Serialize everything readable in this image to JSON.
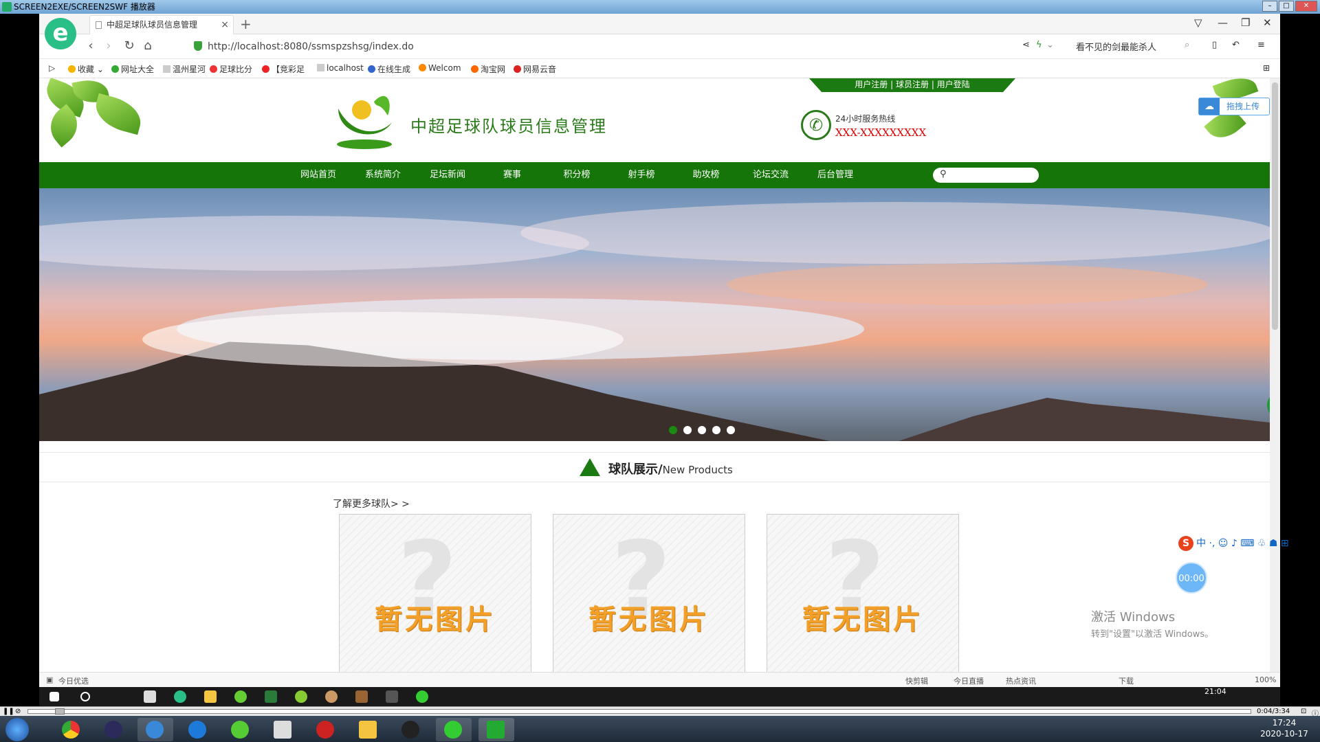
{
  "player": {
    "title": "SCREEN2EXE/SCREEN2SWF 播放器",
    "elapsed": "0:04/3:34"
  },
  "browser": {
    "tab_title": "中超足球队球员信息管理",
    "url": "http://localhost:8080/ssmspzshsg/index.do",
    "search_hint": "看不见的剑最能杀人",
    "bookmarks": [
      "收藏",
      "网址大全",
      "温州星河",
      "足球比分",
      "【竞彩足",
      "localhost",
      "在线生成",
      "Welcom",
      "淘宝网",
      "网易云音"
    ],
    "statusbar": {
      "left": "今日优选",
      "right_items": [
        "快剪辑",
        "今日直播",
        "热点资讯",
        "下载",
        "100%"
      ]
    }
  },
  "site": {
    "top_links": [
      "用户注册",
      "球员注册",
      "用户登陆"
    ],
    "title": "中超足球队球员信息管理",
    "hotline_label": "24小时服务热线",
    "hotline_number": "XXX-XXXXXXXXX",
    "upload_label": "拖拽上传",
    "nav": [
      "网站首页",
      "系统简介",
      "足坛新闻",
      "赛事",
      "积分榜",
      "射手榜",
      "助攻榜",
      "论坛交流",
      "后台管理"
    ],
    "banner_slides": 5,
    "banner_active": 1,
    "section_title": "球队展示/",
    "section_subtitle": "New Products",
    "more_link": "了解更多球队> >",
    "cards": [
      {
        "placeholder": "暂无图片"
      },
      {
        "placeholder": "暂无图片"
      },
      {
        "placeholder": "暂无图片"
      }
    ]
  },
  "overlay": {
    "timer": "00:00",
    "activate_title": "激活 Windows",
    "activate_sub": "转到\"设置\"以激活 Windows。",
    "ime_label": "中"
  },
  "virtual_taskbar": {
    "time": "21:04"
  },
  "taskbar": {
    "time": "17:24",
    "date": "2020-10-17"
  },
  "colors": {
    "nav_green": "#157508",
    "title_green": "#2a7a1a",
    "hotline_red": "#e00000",
    "placeholder_orange": "#f3a02a"
  }
}
